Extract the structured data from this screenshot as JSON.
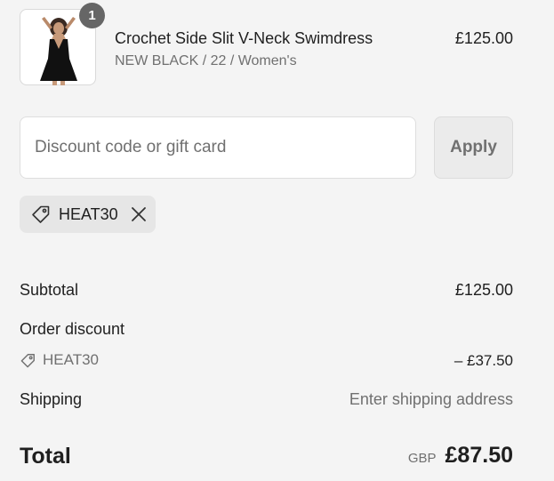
{
  "product": {
    "name": "Crochet Side Slit V-Neck Swimdress",
    "variant": "NEW BLACK / 22 / Women's",
    "price": "£125.00",
    "quantity": "1",
    "image_icon": "swimdress-product-photo"
  },
  "discount": {
    "placeholder": "Discount code or gift card",
    "value": "",
    "apply_label": "Apply",
    "applied_code": "HEAT30"
  },
  "summary": {
    "subtotal_label": "Subtotal",
    "subtotal_value": "£125.00",
    "order_discount_label": "Order discount",
    "discount_code": "HEAT30",
    "discount_amount": "– £37.50",
    "shipping_label": "Shipping",
    "shipping_value": "Enter shipping address",
    "total_label": "Total",
    "currency": "GBP",
    "total_value": "£87.50"
  },
  "colors": {
    "background": "#f4f4f4",
    "text": "#1f1f1f",
    "muted": "#707070",
    "badge": "#666666"
  }
}
